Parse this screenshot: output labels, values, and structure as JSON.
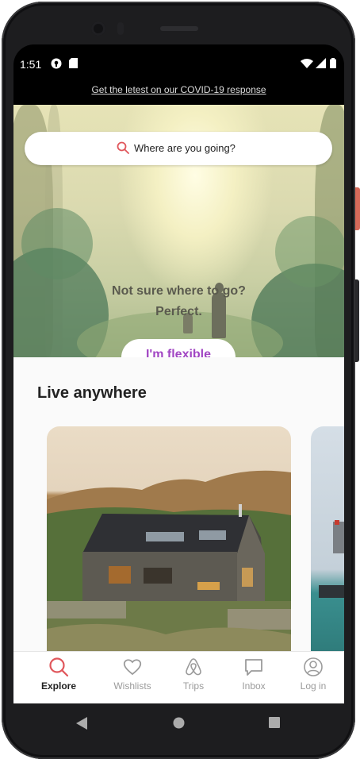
{
  "status_bar": {
    "time": "1:51"
  },
  "banner": {
    "text": "Get the letest on our COVID-19 response"
  },
  "search": {
    "placeholder": "Where are you going?"
  },
  "hero": {
    "line1": "Not sure where to go?",
    "line2": "Perfect.",
    "button_label": "I'm flexible"
  },
  "section": {
    "title": "Live anywhere"
  },
  "tabs": [
    {
      "label": "Explore",
      "icon": "search-icon",
      "active": true
    },
    {
      "label": "Wishlists",
      "icon": "heart-icon",
      "active": false
    },
    {
      "label": "Trips",
      "icon": "airbnb-logo-icon",
      "active": false
    },
    {
      "label": "Inbox",
      "icon": "message-icon",
      "active": false
    },
    {
      "label": "Log in",
      "icon": "user-icon",
      "active": false
    }
  ],
  "colors": {
    "accent": "#e0565b",
    "flexible": "#a146c3"
  }
}
